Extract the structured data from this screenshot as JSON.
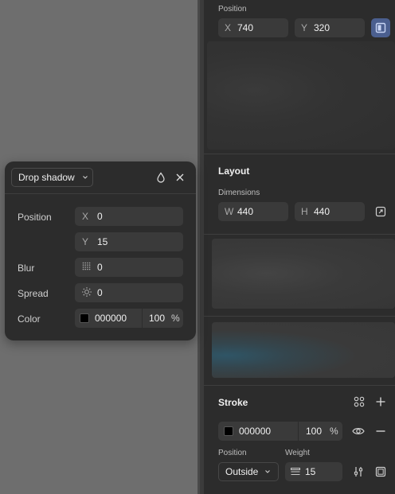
{
  "colors": {
    "panel": "#2c2c2c",
    "field": "#3a3a3a",
    "accent": "#4b5f8f",
    "canvas": "#6e6e6e"
  },
  "position": {
    "label": "Position",
    "x_prefix": "X",
    "x_value": "740",
    "y_prefix": "Y",
    "y_value": "320",
    "constraint_icon": "frame-constraint-icon"
  },
  "layout": {
    "title": "Layout",
    "dimensions_label": "Dimensions",
    "w_prefix": "W",
    "w_value": "440",
    "h_prefix": "H",
    "h_value": "440",
    "resize_icon": "resize-to-fit-icon"
  },
  "stroke": {
    "title": "Stroke",
    "color_value": "000000",
    "opacity_value": "100",
    "opacity_unit": "%",
    "position_label": "Position",
    "position_value": "Outside",
    "weight_label": "Weight",
    "weight_value": "15"
  },
  "effect_popup": {
    "type_label": "Drop shadow",
    "rows": {
      "position_label": "Position",
      "x_prefix": "X",
      "x_value": "0",
      "y_prefix": "Y",
      "y_value": "15",
      "blur_label": "Blur",
      "blur_value": "0",
      "spread_label": "Spread",
      "spread_value": "0",
      "color_label": "Color",
      "color_value": "000000",
      "opacity_value": "100",
      "opacity_unit": "%"
    }
  }
}
